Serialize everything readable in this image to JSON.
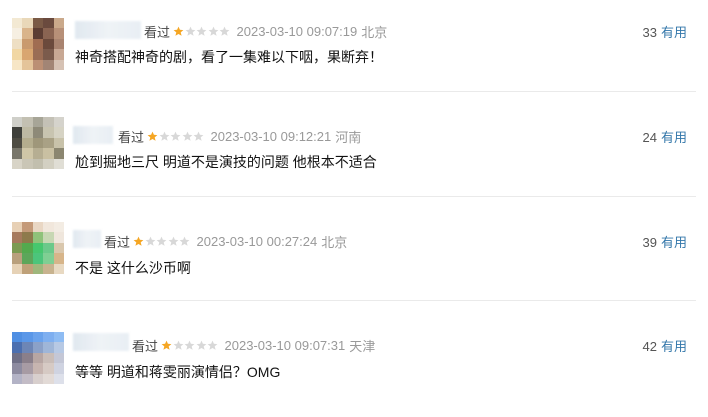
{
  "comments": [
    {
      "status": "看过",
      "rating": 1,
      "time": "2023-03-10 09:07:19",
      "region": "北京",
      "text": "神奇搭配神奇的剧，看了一集难以下咽，果断弃！",
      "votes": "33",
      "useful_label": "有用"
    },
    {
      "status": "看过",
      "rating": 1,
      "time": "2023-03-10 09:12:21",
      "region": "河南",
      "text": "尬到掘地三尺 明道不是演技的问题 他根本不适合",
      "votes": "24",
      "useful_label": "有用"
    },
    {
      "status": "看过",
      "rating": 1,
      "time": "2023-03-10 00:27:24",
      "region": "北京",
      "text": "不是 这什么沙币啊",
      "votes": "39",
      "useful_label": "有用"
    },
    {
      "status": "看过",
      "rating": 1,
      "time": "2023-03-10 09:07:31",
      "region": "天津",
      "text": "等等 明道和蒋雯丽演情侣？OMG",
      "votes": "42",
      "useful_label": "有用"
    }
  ],
  "colors": {
    "star_filled": "#f5a623",
    "star_empty": "#d8d8d8",
    "link": "#3377aa"
  }
}
